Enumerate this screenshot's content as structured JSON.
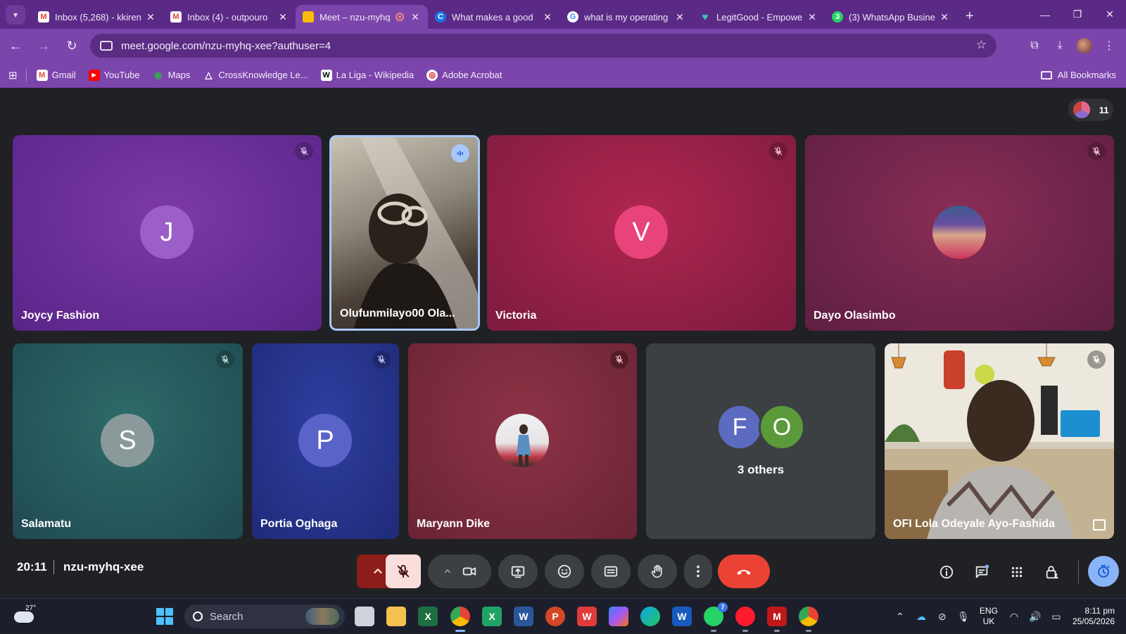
{
  "tabs": [
    {
      "title": "Inbox (5,268) - kkiren",
      "favicon": "gmail-icon",
      "active": false
    },
    {
      "title": "Inbox (4) - outpouro",
      "favicon": "gmail-icon",
      "active": false
    },
    {
      "title": "Meet – nzu-myhq",
      "favicon": "meet-icon",
      "active": true
    },
    {
      "title": "What makes a good",
      "favicon": "c-icon",
      "active": false
    },
    {
      "title": "what is my operating",
      "favicon": "google-icon",
      "active": false
    },
    {
      "title": "LegitGood - Empowe",
      "favicon": "heart-icon",
      "active": false
    },
    {
      "title": "(3) WhatsApp Busine",
      "favicon": "whatsapp-business-icon",
      "active": false
    }
  ],
  "address": {
    "url": "meet.google.com/nzu-myhq-xee?authuser=4"
  },
  "bookmarks": [
    {
      "label": "Gmail",
      "icon": "gmail-icon"
    },
    {
      "label": "YouTube",
      "icon": "youtube-icon"
    },
    {
      "label": "Maps",
      "icon": "maps-icon"
    },
    {
      "label": "CrossKnowledge Le...",
      "icon": "crossknowledge-icon"
    },
    {
      "label": "La Liga - Wikipedia",
      "icon": "wikipedia-icon"
    },
    {
      "label": "Adobe Acrobat",
      "icon": "acrobat-icon"
    }
  ],
  "all_bookmarks": "All Bookmarks",
  "meet": {
    "participant_count": "11",
    "participants": [
      {
        "name": "Joycy Fashion",
        "initial": "J"
      },
      {
        "name": "Olufunmilayo00 Ola...",
        "initial": ""
      },
      {
        "name": "Victoria",
        "initial": "V"
      },
      {
        "name": "Dayo Olasimbo",
        "initial": ""
      },
      {
        "name": "Salamatu",
        "initial": "S"
      },
      {
        "name": "Portia Oghaga",
        "initial": "P"
      },
      {
        "name": "Maryann Dike",
        "initial": ""
      },
      {
        "name": "",
        "initial": ""
      },
      {
        "name": "OFI Lola Odeyale Ayo-Fashida",
        "initial": ""
      }
    ],
    "others": {
      "initials": [
        "F",
        "O"
      ],
      "label": "3 others"
    },
    "time": "20:11",
    "meeting_code": "nzu-myhq-xee"
  },
  "taskbar": {
    "weather_temp": "27°",
    "search_placeholder": "Search",
    "lang_line1": "ENG",
    "lang_line2": "UK",
    "time": "8:11 pm",
    "date": "25/05/2026",
    "whatsapp_badge": "7"
  },
  "colors": {
    "browser_accent": "#7b45ab",
    "end_call_red": "#ea4335",
    "mic_off_bg": "#f9dedc"
  }
}
